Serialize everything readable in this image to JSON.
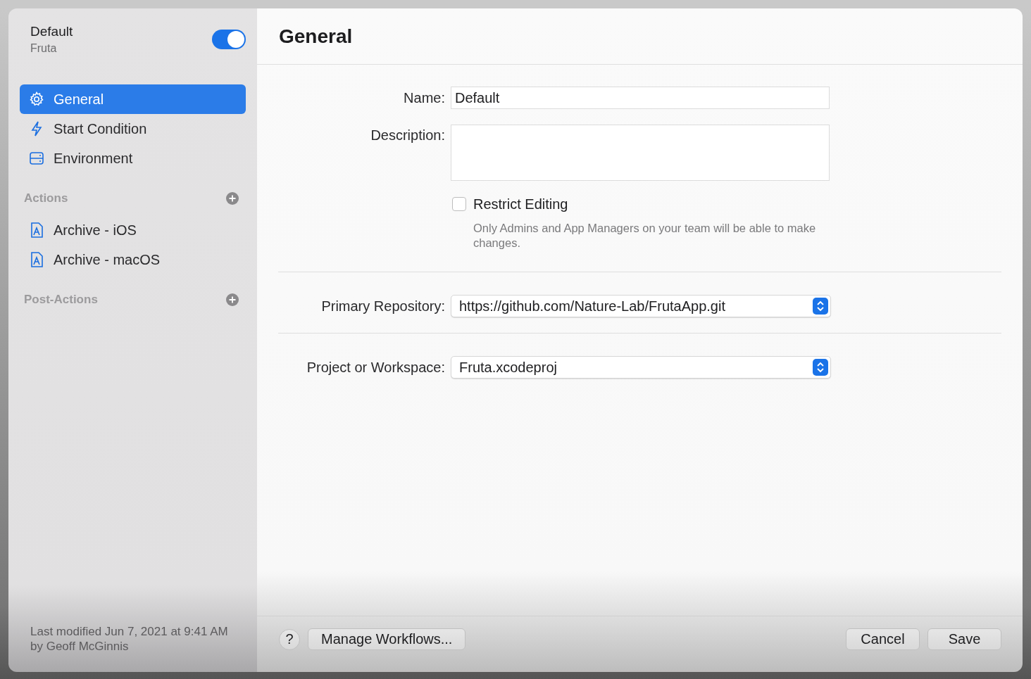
{
  "sidebar": {
    "title": "Default",
    "subtitle": "Fruta",
    "enabled": true,
    "items": [
      {
        "label": "General",
        "selected": true
      },
      {
        "label": "Start Condition",
        "selected": false
      },
      {
        "label": "Environment",
        "selected": false
      }
    ],
    "sections": [
      {
        "title": "Actions",
        "items": [
          {
            "label": "Archive - iOS",
            "selected": false
          },
          {
            "label": "Archive - macOS",
            "selected": false
          }
        ]
      },
      {
        "title": "Post-Actions"
      }
    ],
    "footer": "Last modified Jun 7, 2021 at 9:41 AM\nby Geoff McGinnis"
  },
  "main": {
    "title": "General",
    "name": {
      "label": "Name:",
      "value": "Default"
    },
    "description": {
      "label": "Description:"
    },
    "restrict": {
      "label": "Restrict Editing",
      "hint": "Only Admins and App Managers on your team will be able to make changes.",
      "checked": false
    },
    "repository": {
      "label": "Primary Repository:",
      "value": "https://github.com/Nature-Lab/FrutaApp.git"
    },
    "project": {
      "label": "Project or Workspace:",
      "value": "Fruta.xcodeproj"
    }
  },
  "buttons": {
    "help": "?",
    "manage": "Manage Workflows...",
    "cancel": "Cancel",
    "save": "Save"
  }
}
